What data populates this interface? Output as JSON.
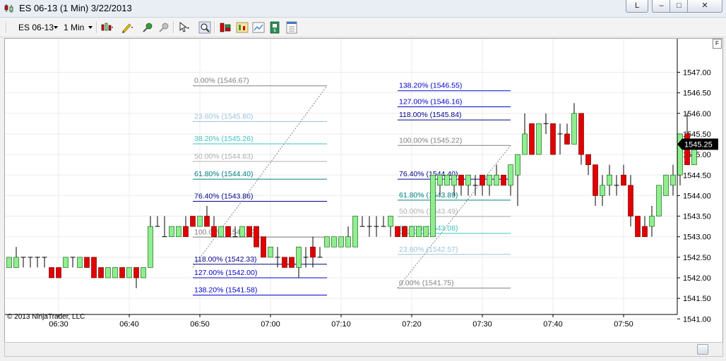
{
  "window": {
    "title": "ES 06-13 (1 Min)  3/22/2013",
    "btn_l": "L",
    "btn_min": "–",
    "btn_max": "□",
    "btn_close": "✕"
  },
  "toolbar": {
    "instrument": "ES 06-13",
    "interval": "1 Min",
    "icons": [
      "bar-type-icon",
      "draw-pencil-icon",
      "indicators-icon",
      "strategies-icon",
      "cursor-icon",
      "zoom-icon",
      "data-box-icon",
      "chart-trader-icon",
      "chart-image-icon",
      "save-icon",
      "properties-icon"
    ]
  },
  "chart": {
    "copyright": "© 2013 NinjaTrader, LLC",
    "f_button": "F",
    "colors": {
      "up": "#90ee90",
      "down": "#e00000",
      "wick": "#000000",
      "grid": "#ebebeb",
      "price_tag_bg": "#000000",
      "price_tag_text": "#ffffff"
    }
  },
  "chart_data": {
    "type": "candlestick",
    "x_ticks": [
      "06:30",
      "06:40",
      "06:50",
      "07:00",
      "07:10",
      "07:20",
      "07:30",
      "07:40",
      "07:50"
    ],
    "y_ticks": [
      "1547.00",
      "1546.50",
      "1546.00",
      "1545.50",
      "1545.00",
      "1544.50",
      "1544.00",
      "1543.50",
      "1543.00",
      "1542.50",
      "1542.00",
      "1541.50",
      "1541.00"
    ],
    "ylim": [
      1540.75,
      1547.25
    ],
    "last_price": "1545.25",
    "first_bar_time": "06:22",
    "candles": [
      {
        "o": 1542.25,
        "h": 1542.5,
        "l": 1542.25,
        "c": 1542.5
      },
      {
        "o": 1542.25,
        "h": 1542.5,
        "l": 1542.25,
        "c": 1542.5
      },
      {
        "o": 1542.25,
        "h": 1542.75,
        "l": 1542.25,
        "c": 1542.5
      },
      {
        "o": 1542.5,
        "h": 1542.5,
        "l": 1542.25,
        "c": 1542.5
      },
      {
        "o": 1542.5,
        "h": 1542.5,
        "l": 1542.25,
        "c": 1542.5
      },
      {
        "o": 1542.5,
        "h": 1542.5,
        "l": 1542.25,
        "c": 1542.5
      },
      {
        "o": 1542.5,
        "h": 1542.5,
        "l": 1542.25,
        "c": 1542.5
      },
      {
        "o": 1542.25,
        "h": 1542.25,
        "l": 1542.0,
        "c": 1542.0
      },
      {
        "o": 1542.25,
        "h": 1542.25,
        "l": 1542.0,
        "c": 1542.0
      },
      {
        "o": 1542.25,
        "h": 1542.5,
        "l": 1542.25,
        "c": 1542.5
      },
      {
        "o": 1542.5,
        "h": 1542.5,
        "l": 1542.25,
        "c": 1542.5
      },
      {
        "o": 1542.25,
        "h": 1542.5,
        "l": 1542.25,
        "c": 1542.5
      },
      {
        "o": 1542.5,
        "h": 1542.5,
        "l": 1542.25,
        "c": 1542.25
      },
      {
        "o": 1542.5,
        "h": 1542.5,
        "l": 1542.0,
        "c": 1542.0
      },
      {
        "o": 1542.25,
        "h": 1542.25,
        "l": 1542.0,
        "c": 1542.0
      },
      {
        "o": 1542.0,
        "h": 1542.25,
        "l": 1542.0,
        "c": 1542.25
      },
      {
        "o": 1542.0,
        "h": 1542.25,
        "l": 1542.0,
        "c": 1542.25
      },
      {
        "o": 1542.25,
        "h": 1542.25,
        "l": 1542.0,
        "c": 1542.0
      },
      {
        "o": 1542.0,
        "h": 1542.25,
        "l": 1542.0,
        "c": 1542.25
      },
      {
        "o": 1542.25,
        "h": 1542.25,
        "l": 1541.75,
        "c": 1542.0
      },
      {
        "o": 1542.0,
        "h": 1542.25,
        "l": 1542.0,
        "c": 1542.25
      },
      {
        "o": 1542.25,
        "h": 1543.5,
        "l": 1542.25,
        "c": 1543.25
      },
      {
        "o": 1543.25,
        "h": 1543.5,
        "l": 1543.25,
        "c": 1543.25
      },
      {
        "o": 1543.0,
        "h": 1543.5,
        "l": 1543.0,
        "c": 1543.0
      },
      {
        "o": 1543.0,
        "h": 1543.25,
        "l": 1543.0,
        "c": 1543.25
      },
      {
        "o": 1543.0,
        "h": 1543.25,
        "l": 1543.0,
        "c": 1543.25
      },
      {
        "o": 1543.25,
        "h": 1543.5,
        "l": 1543.0,
        "c": 1543.0
      },
      {
        "o": 1543.5,
        "h": 1543.5,
        "l": 1543.25,
        "c": 1543.25
      },
      {
        "o": 1543.25,
        "h": 1543.5,
        "l": 1543.25,
        "c": 1543.5
      },
      {
        "o": 1543.5,
        "h": 1543.75,
        "l": 1543.25,
        "c": 1543.25
      },
      {
        "o": 1543.25,
        "h": 1543.5,
        "l": 1543.0,
        "c": 1543.0
      },
      {
        "o": 1543.0,
        "h": 1543.25,
        "l": 1543.0,
        "c": 1543.25
      },
      {
        "o": 1543.25,
        "h": 1543.25,
        "l": 1543.0,
        "c": 1543.0
      },
      {
        "o": 1543.0,
        "h": 1543.25,
        "l": 1543.0,
        "c": 1543.0
      },
      {
        "o": 1543.0,
        "h": 1543.25,
        "l": 1543.0,
        "c": 1543.25
      },
      {
        "o": 1543.25,
        "h": 1543.25,
        "l": 1543.0,
        "c": 1543.0
      },
      {
        "o": 1543.25,
        "h": 1543.25,
        "l": 1542.75,
        "c": 1542.75
      },
      {
        "o": 1543.0,
        "h": 1543.0,
        "l": 1542.5,
        "c": 1542.5
      },
      {
        "o": 1542.5,
        "h": 1542.75,
        "l": 1542.5,
        "c": 1542.75
      },
      {
        "o": 1542.5,
        "h": 1542.75,
        "l": 1542.25,
        "c": 1542.5
      },
      {
        "o": 1542.5,
        "h": 1542.5,
        "l": 1542.25,
        "c": 1542.25
      },
      {
        "o": 1542.5,
        "h": 1542.5,
        "l": 1542.25,
        "c": 1542.25
      },
      {
        "o": 1542.25,
        "h": 1542.75,
        "l": 1542.0,
        "c": 1542.75
      },
      {
        "o": 1542.5,
        "h": 1542.75,
        "l": 1542.25,
        "c": 1542.5
      },
      {
        "o": 1542.75,
        "h": 1543.0,
        "l": 1542.25,
        "c": 1542.5
      },
      {
        "o": 1542.5,
        "h": 1542.75,
        "l": 1542.5,
        "c": 1542.5
      },
      {
        "o": 1542.75,
        "h": 1543.0,
        "l": 1542.75,
        "c": 1543.0
      },
      {
        "o": 1542.75,
        "h": 1543.0,
        "l": 1542.75,
        "c": 1543.0
      },
      {
        "o": 1542.75,
        "h": 1543.0,
        "l": 1542.75,
        "c": 1543.0
      },
      {
        "o": 1542.75,
        "h": 1543.25,
        "l": 1542.75,
        "c": 1543.0
      },
      {
        "o": 1542.75,
        "h": 1543.5,
        "l": 1542.75,
        "c": 1543.5
      },
      {
        "o": 1543.25,
        "h": 1543.5,
        "l": 1543.25,
        "c": 1543.25
      },
      {
        "o": 1543.25,
        "h": 1543.5,
        "l": 1543.0,
        "c": 1543.25
      },
      {
        "o": 1543.25,
        "h": 1543.5,
        "l": 1543.0,
        "c": 1543.25
      },
      {
        "o": 1543.25,
        "h": 1543.5,
        "l": 1543.25,
        "c": 1543.25
      },
      {
        "o": 1543.25,
        "h": 1543.5,
        "l": 1543.0,
        "c": 1543.5
      },
      {
        "o": 1543.25,
        "h": 1543.25,
        "l": 1543.0,
        "c": 1543.0
      },
      {
        "o": 1543.25,
        "h": 1543.25,
        "l": 1543.0,
        "c": 1543.0
      },
      {
        "o": 1543.0,
        "h": 1543.25,
        "l": 1543.0,
        "c": 1543.25
      },
      {
        "o": 1543.0,
        "h": 1543.25,
        "l": 1543.0,
        "c": 1543.25
      },
      {
        "o": 1543.0,
        "h": 1543.25,
        "l": 1543.0,
        "c": 1543.25
      },
      {
        "o": 1543.0,
        "h": 1544.5,
        "l": 1543.0,
        "c": 1544.5
      },
      {
        "o": 1544.25,
        "h": 1544.5,
        "l": 1544.0,
        "c": 1544.5
      },
      {
        "o": 1544.25,
        "h": 1544.5,
        "l": 1544.25,
        "c": 1544.5
      },
      {
        "o": 1544.25,
        "h": 1544.5,
        "l": 1544.0,
        "c": 1544.5
      },
      {
        "o": 1544.5,
        "h": 1544.5,
        "l": 1544.0,
        "c": 1544.25
      },
      {
        "o": 1544.25,
        "h": 1544.5,
        "l": 1544.0,
        "c": 1544.5
      },
      {
        "o": 1544.25,
        "h": 1544.5,
        "l": 1544.0,
        "c": 1544.25
      },
      {
        "o": 1544.5,
        "h": 1544.5,
        "l": 1544.0,
        "c": 1544.25
      },
      {
        "o": 1544.25,
        "h": 1544.5,
        "l": 1544.0,
        "c": 1544.5
      },
      {
        "o": 1544.25,
        "h": 1544.75,
        "l": 1544.25,
        "c": 1544.5
      },
      {
        "o": 1544.5,
        "h": 1544.5,
        "l": 1544.25,
        "c": 1544.25
      },
      {
        "o": 1544.25,
        "h": 1544.75,
        "l": 1544.0,
        "c": 1544.75
      },
      {
        "o": 1544.5,
        "h": 1545.0,
        "l": 1543.75,
        "c": 1545.0
      },
      {
        "o": 1545.0,
        "h": 1546.0,
        "l": 1545.0,
        "c": 1545.5
      },
      {
        "o": 1545.75,
        "h": 1545.75,
        "l": 1545.0,
        "c": 1545.0
      },
      {
        "o": 1545.0,
        "h": 1545.75,
        "l": 1545.0,
        "c": 1545.75
      },
      {
        "o": 1545.75,
        "h": 1546.0,
        "l": 1545.5,
        "c": 1545.75
      },
      {
        "o": 1545.75,
        "h": 1545.75,
        "l": 1545.0,
        "c": 1545.0
      },
      {
        "o": 1545.5,
        "h": 1545.75,
        "l": 1545.0,
        "c": 1545.5
      },
      {
        "o": 1545.5,
        "h": 1545.75,
        "l": 1545.25,
        "c": 1545.25
      },
      {
        "o": 1545.25,
        "h": 1546.25,
        "l": 1545.25,
        "c": 1546.0
      },
      {
        "o": 1546.0,
        "h": 1546.0,
        "l": 1544.75,
        "c": 1545.0
      },
      {
        "o": 1545.0,
        "h": 1545.0,
        "l": 1544.5,
        "c": 1544.75
      },
      {
        "o": 1544.75,
        "h": 1544.75,
        "l": 1543.75,
        "c": 1544.0
      },
      {
        "o": 1544.0,
        "h": 1544.5,
        "l": 1543.75,
        "c": 1544.25
      },
      {
        "o": 1544.25,
        "h": 1544.75,
        "l": 1544.0,
        "c": 1544.5
      },
      {
        "o": 1544.25,
        "h": 1544.5,
        "l": 1544.0,
        "c": 1544.25
      },
      {
        "o": 1544.5,
        "h": 1544.75,
        "l": 1544.25,
        "c": 1544.25
      },
      {
        "o": 1544.25,
        "h": 1544.5,
        "l": 1543.25,
        "c": 1543.5
      },
      {
        "o": 1543.5,
        "h": 1543.5,
        "l": 1543.0,
        "c": 1543.0
      },
      {
        "o": 1543.25,
        "h": 1543.5,
        "l": 1543.0,
        "c": 1543.0
      },
      {
        "o": 1543.25,
        "h": 1543.75,
        "l": 1543.0,
        "c": 1543.5
      },
      {
        "o": 1543.5,
        "h": 1544.25,
        "l": 1543.5,
        "c": 1544.25
      },
      {
        "o": 1544.0,
        "h": 1544.5,
        "l": 1544.0,
        "c": 1544.5
      },
      {
        "o": 1544.25,
        "h": 1544.75,
        "l": 1544.0,
        "c": 1544.5
      },
      {
        "o": 1544.5,
        "h": 1545.5,
        "l": 1544.25,
        "c": 1545.5
      },
      {
        "o": 1545.5,
        "h": 1546.0,
        "l": 1544.75,
        "c": 1544.75
      },
      {
        "o": 1544.75,
        "h": 1545.25,
        "l": 1544.75,
        "c": 1545.25
      }
    ],
    "fib_sets": [
      {
        "name": "fib-left",
        "x_start": "06:49",
        "x_end": "07:08",
        "trend": {
          "from_price": 1542.25,
          "to_price": 1546.67
        },
        "levels": [
          {
            "label": "0.00% (1546.67)",
            "price": 1546.67,
            "color": "#808080"
          },
          {
            "label": "23.60% (1545.80)",
            "price": 1545.8,
            "color": "#9cc3e0"
          },
          {
            "label": "38.20% (1545.26)",
            "price": 1545.26,
            "color": "#40c0c0"
          },
          {
            "label": "50.00% (1544.83)",
            "price": 1544.83,
            "color": "#b0b0b0"
          },
          {
            "label": "61.80% (1544.40)",
            "price": 1544.4,
            "color": "#008080"
          },
          {
            "label": "76.40% (1543.86)",
            "price": 1543.86,
            "color": "#00008b"
          },
          {
            "label": "100.00% (1542.99)",
            "price": 1542.99,
            "color": "#808080"
          },
          {
            "label": "118.00% (1542.33)",
            "price": 1542.33,
            "color": "#00008b"
          },
          {
            "label": "127.00% (1542.00)",
            "price": 1542.0,
            "color": "#0000cd"
          },
          {
            "label": "138.20% (1541.58)",
            "price": 1541.58,
            "color": "#0000cd"
          }
        ]
      },
      {
        "name": "fib-right",
        "x_start": "07:18",
        "x_end": "07:34",
        "trend": {
          "from_price": 1541.75,
          "to_price": 1545.22
        },
        "levels": [
          {
            "label": "138.20% (1546.55)",
            "price": 1546.55,
            "color": "#0000cd"
          },
          {
            "label": "127.00% (1546.16)",
            "price": 1546.16,
            "color": "#0000cd"
          },
          {
            "label": "118.00% (1545.84)",
            "price": 1545.84,
            "color": "#00008b"
          },
          {
            "label": "100.00% (1545.22)",
            "price": 1545.22,
            "color": "#808080"
          },
          {
            "label": "76.40% (1544.40)",
            "price": 1544.4,
            "color": "#00008b"
          },
          {
            "label": "61.80% (1543.89)",
            "price": 1543.89,
            "color": "#008080"
          },
          {
            "label": "50.00% (1543.49)",
            "price": 1543.49,
            "color": "#b0b0b0"
          },
          {
            "label": "38.20% (1543.08)",
            "price": 1543.08,
            "color": "#40c0c0"
          },
          {
            "label": "23.60% (1542.57)",
            "price": 1542.57,
            "color": "#9cc3e0"
          },
          {
            "label": "0.00% (1541.75)",
            "price": 1541.75,
            "color": "#808080"
          }
        ]
      }
    ]
  }
}
